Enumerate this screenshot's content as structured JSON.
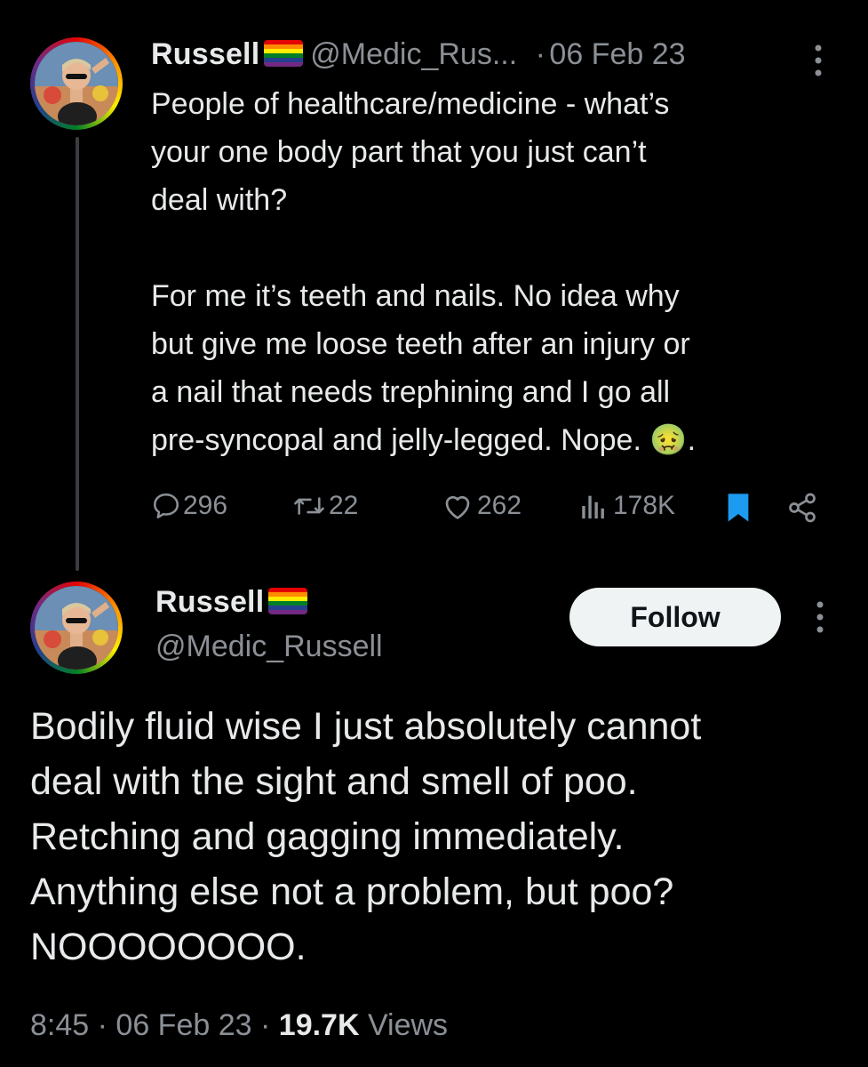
{
  "original_tweet": {
    "display_name": "Russell",
    "flag_icon": "rainbow-flag-icon",
    "handle": "@Medic_Rus...",
    "separator": "·",
    "date": "06 Feb 23",
    "text": "People of healthcare/medicine - what’s\nyour one body part that you just can’t\ndeal with?\n\nFor me it’s teeth and nails. No idea why\nbut give me loose teeth after an injury or\na nail that needs trephining and I go all\npre-syncopal and jelly-legged. Nope. 🤢.",
    "stats": {
      "replies": "296",
      "retweets": "22",
      "likes": "262",
      "views": "178K"
    }
  },
  "reply_tweet": {
    "display_name": "Russell",
    "flag_icon": "rainbow-flag-icon",
    "handle": "@Medic_Russell",
    "follow_label": "Follow",
    "text": "Bodily fluid wise I just absolutely cannot\ndeal with the sight and smell of poo.\nRetching and gagging immediately.\nAnything else not a problem, but poo?\nNOOOOOOOO.",
    "time": "8:45",
    "date": "06 Feb 23",
    "views_count": "19.7K",
    "views_label": "Views",
    "separator": "·"
  },
  "colors": {
    "background": "#000000",
    "text": "#e7e9ea",
    "muted": "#8b9096",
    "bookmark_active": "#1d9bf0",
    "follow_bg": "#eff3f4"
  }
}
